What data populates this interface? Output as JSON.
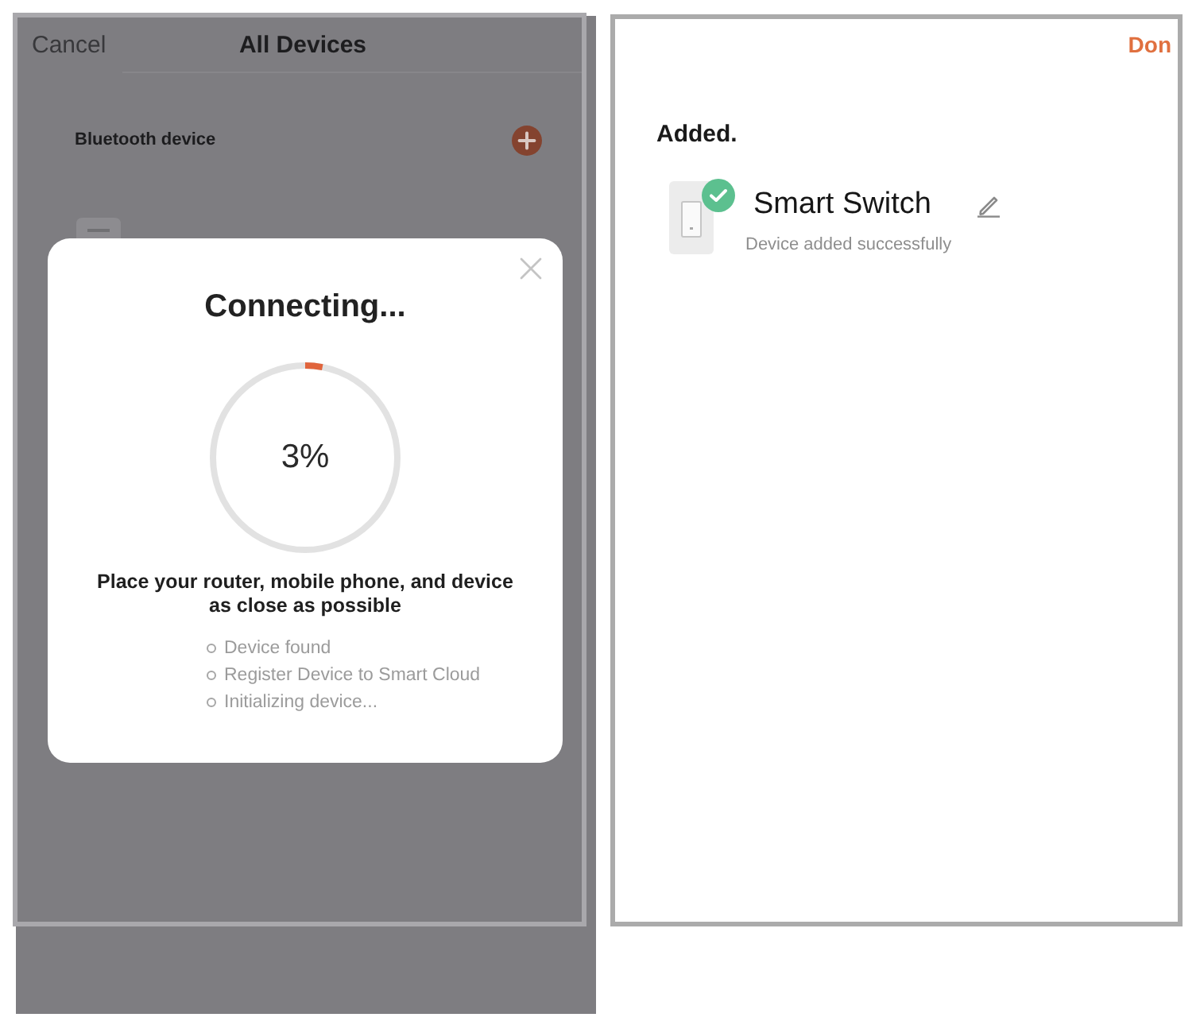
{
  "left_screen": {
    "nav": {
      "cancel": "Cancel",
      "title": "All Devices"
    },
    "section": {
      "label": "Bluetooth device"
    }
  },
  "dialog": {
    "title": "Connecting...",
    "progress": {
      "level": 0.03,
      "reading": "3%"
    },
    "hint": "Place your router, mobile phone, and device as close as possible",
    "steps": [
      "Device found",
      "Register Device to Smart Cloud",
      "Initializing device..."
    ]
  },
  "right_screen": {
    "done": "Don",
    "heading": "Added.",
    "devices": [
      {
        "name": "Smart Switch",
        "status": "Device added successfully",
        "added": true
      }
    ]
  }
}
